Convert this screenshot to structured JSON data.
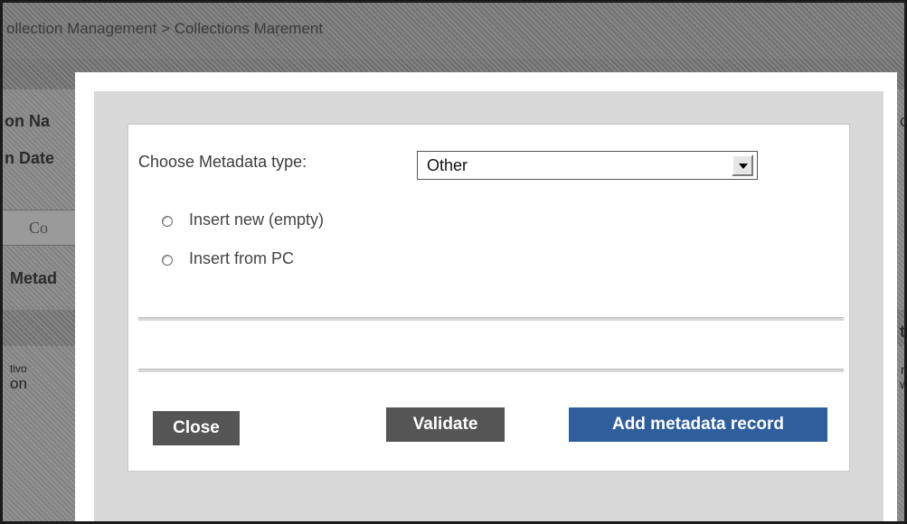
{
  "header": {
    "breadcrumb": "ollection Management > Collections Maṛement"
  },
  "background": {
    "field_name": "on Na",
    "field_date": "n Date",
    "tab_label": "Co",
    "section_label": "Metad",
    "row_text_1": "tivo",
    "row_text_2": "on",
    "right_c": "c",
    "right_t": "t",
    "right_r": "r",
    "right_w": "w"
  },
  "dialog": {
    "metadata_type_label": "Choose Metadata type:",
    "metadata_type_value": "Other",
    "options": [
      {
        "label": "Insert new (empty)",
        "selected": false
      },
      {
        "label": "Insert from PC",
        "selected": false
      }
    ],
    "buttons": {
      "close": "Close",
      "validate": "Validate",
      "add": "Add metadata record"
    }
  },
  "colors": {
    "primary_button": "#2e5e9c",
    "secondary_button": "#555555"
  }
}
